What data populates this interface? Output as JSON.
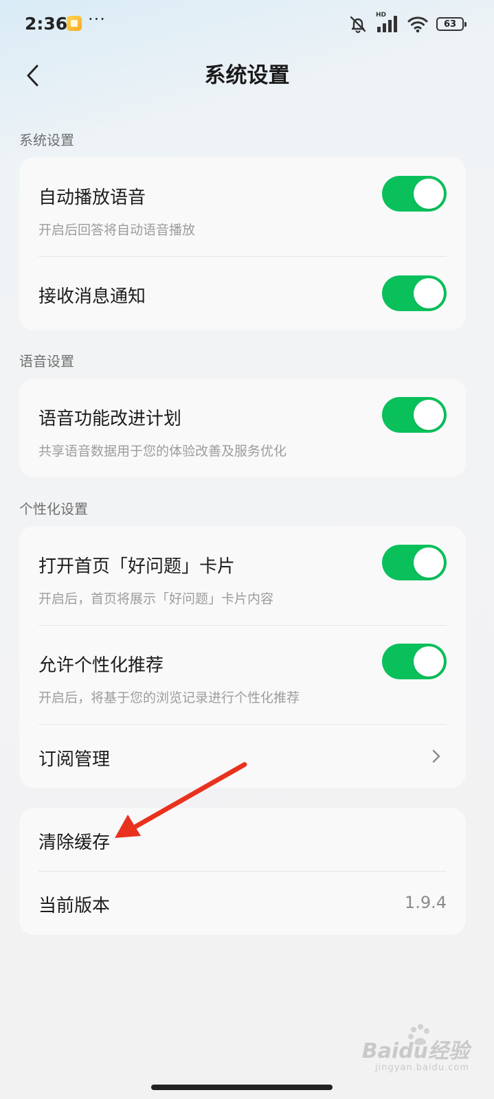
{
  "status_bar": {
    "time": "2:36",
    "more": "···",
    "network_label": "HD",
    "battery": "63"
  },
  "header": {
    "title": "系统设置"
  },
  "sections": [
    {
      "header": "系统设置",
      "items": [
        {
          "title": "自动播放语音",
          "desc": "开启后回答将自动语音播放",
          "control": "toggle",
          "checked": true
        },
        {
          "title": "接收消息通知",
          "control": "toggle",
          "checked": true
        }
      ]
    },
    {
      "header": "语音设置",
      "items": [
        {
          "title": "语音功能改进计划",
          "desc": "共享语音数据用于您的体验改善及服务优化",
          "control": "toggle",
          "checked": true
        }
      ]
    },
    {
      "header": "个性化设置",
      "items": [
        {
          "title": "打开首页「好问题」卡片",
          "desc": "开启后，首页将展示「好问题」卡片内容",
          "control": "toggle",
          "checked": true
        },
        {
          "title": "允许个性化推荐",
          "desc": "开启后，将基于您的浏览记录进行个性化推荐",
          "control": "toggle",
          "checked": true
        },
        {
          "title": "订阅管理",
          "control": "chevron"
        }
      ]
    },
    {
      "items": [
        {
          "title": "清除缓存"
        },
        {
          "title": "当前版本",
          "value": "1.9.4"
        }
      ]
    }
  ],
  "colors": {
    "toggle_on": "#0ac05b",
    "annotation_arrow": "#e8321e"
  },
  "watermark": {
    "logo": "Baidu经验",
    "sub": "jingyan.baidu.com"
  }
}
